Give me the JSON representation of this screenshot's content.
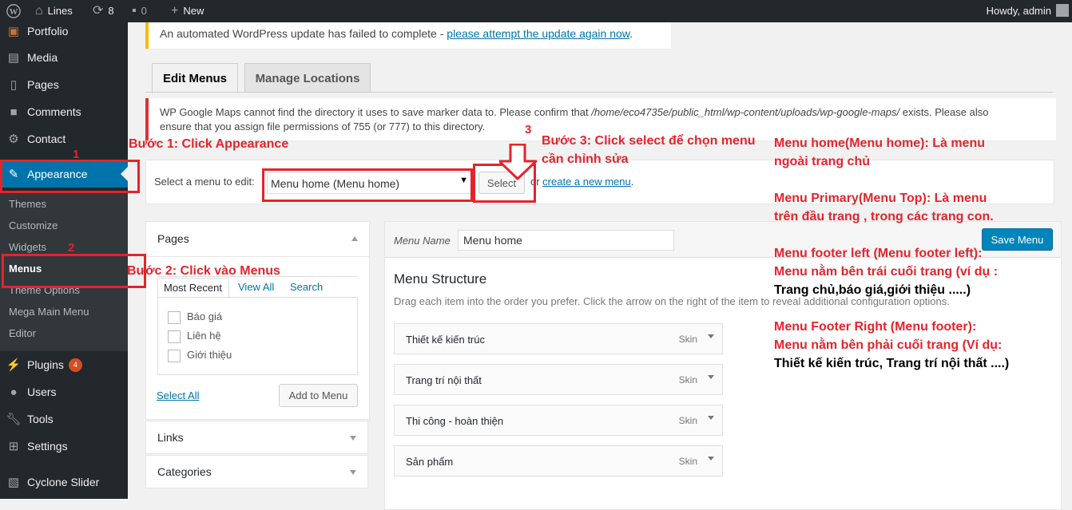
{
  "adminbar": {
    "site_name": "Lines",
    "updates_count": "8",
    "comments_count": "0",
    "new_label": "New",
    "howdy": "Howdy, admin"
  },
  "sidebar": {
    "items": [
      {
        "label": "Portfolio",
        "icon": "portfolio-icon"
      },
      {
        "label": "Media",
        "icon": "media-icon"
      },
      {
        "label": "Pages",
        "icon": "pages-icon"
      },
      {
        "label": "Comments",
        "icon": "comments-icon"
      },
      {
        "label": "Contact",
        "icon": "contact-icon"
      },
      {
        "label": "Appearance",
        "icon": "appearance-icon"
      },
      {
        "label": "Plugins",
        "icon": "plugins-icon",
        "badge": "4"
      },
      {
        "label": "Users",
        "icon": "users-icon"
      },
      {
        "label": "Tools",
        "icon": "tools-icon"
      },
      {
        "label": "Settings",
        "icon": "settings-icon"
      },
      {
        "label": "Cyclone Slider",
        "icon": "slider-icon"
      }
    ],
    "submenu": [
      "Themes",
      "Customize",
      "Widgets",
      "Menus",
      "Theme Options",
      "Mega Main Menu",
      "Editor"
    ]
  },
  "notices": {
    "update_text": "An automated WordPress update has failed to complete - ",
    "update_link": "please attempt the update again now",
    "update_tail": ".",
    "maps_text_1": "WP Google Maps cannot find the directory it uses to save marker data to. Please confirm that ",
    "maps_path": "/home/eco4735e/public_html/wp-content/uploads/wp-google-maps/",
    "maps_text_2": " exists. Please also",
    "maps_text_3": "ensure that you assign file permissions of 755 (or 777) to this directory."
  },
  "tabs": [
    "Edit Menus",
    "Manage Locations"
  ],
  "select_bar": {
    "label": "Select a menu to edit:",
    "selected": "Menu home (Menu home)",
    "select_button": "Select",
    "or_text": "or ",
    "create_link": "create a new menu",
    "period": "."
  },
  "pages_box": {
    "title": "Pages",
    "tabs": [
      "Most Recent",
      "View All",
      "Search"
    ],
    "items": [
      "Báo giá",
      "Liên hệ",
      "Giới thiệu"
    ],
    "select_all": "Select All",
    "add_button": "Add to Menu"
  },
  "accordions": [
    "Links",
    "Categories"
  ],
  "menu_editor": {
    "name_label": "Menu Name",
    "name_value": "Menu home",
    "save_button": "Save Menu",
    "structure_title": "Menu Structure",
    "structure_desc": "Drag each item into the order you prefer. Click the arrow on the right of the item to reveal additional configuration options.",
    "items": [
      {
        "title": "Thiết kế kiến trúc",
        "type": "Skin"
      },
      {
        "title": "Trang trí nội thất",
        "type": "Skin"
      },
      {
        "title": "Thi công - hoàn thiện",
        "type": "Skin"
      },
      {
        "title": "Sản phẩm",
        "type": "Skin"
      }
    ]
  },
  "annotations": {
    "num1": "1",
    "num2": "2",
    "num3": "3",
    "step1": "Bước 1: Click Appearance",
    "step2": "Bước 2: Click vào Menus",
    "step3_line1": "Bước 3: Click select để chọn menu",
    "step3_line2": "cần chỉnh sửa",
    "note1_line1": "Menu home(Menu home): Là menu",
    "note1_line2": "ngoài trang chủ",
    "note2_line1": "Menu Primary(Menu Top): Là menu",
    "note2_line2": "trên đầu trang  , trong các trang con.",
    "note3_line1": "Menu footer left (Menu footer left):",
    "note3_line2": "Menu nằm bên trái cuối trang (ví dụ :",
    "note3_line3": "Trang chủ,báo giá,giới thiệu .....)",
    "note4_line1": "Menu Footer Right (Menu footer):",
    "note4_line2": "Menu nằm bên phải cuối trang (Ví dụ:",
    "note4_line3": "Thiết kế kiến trúc, Trang trí nội thất ....)"
  },
  "colors": {
    "annotation_red": "#e4242b",
    "admin_dark": "#23282d",
    "wp_blue": "#0073aa"
  }
}
